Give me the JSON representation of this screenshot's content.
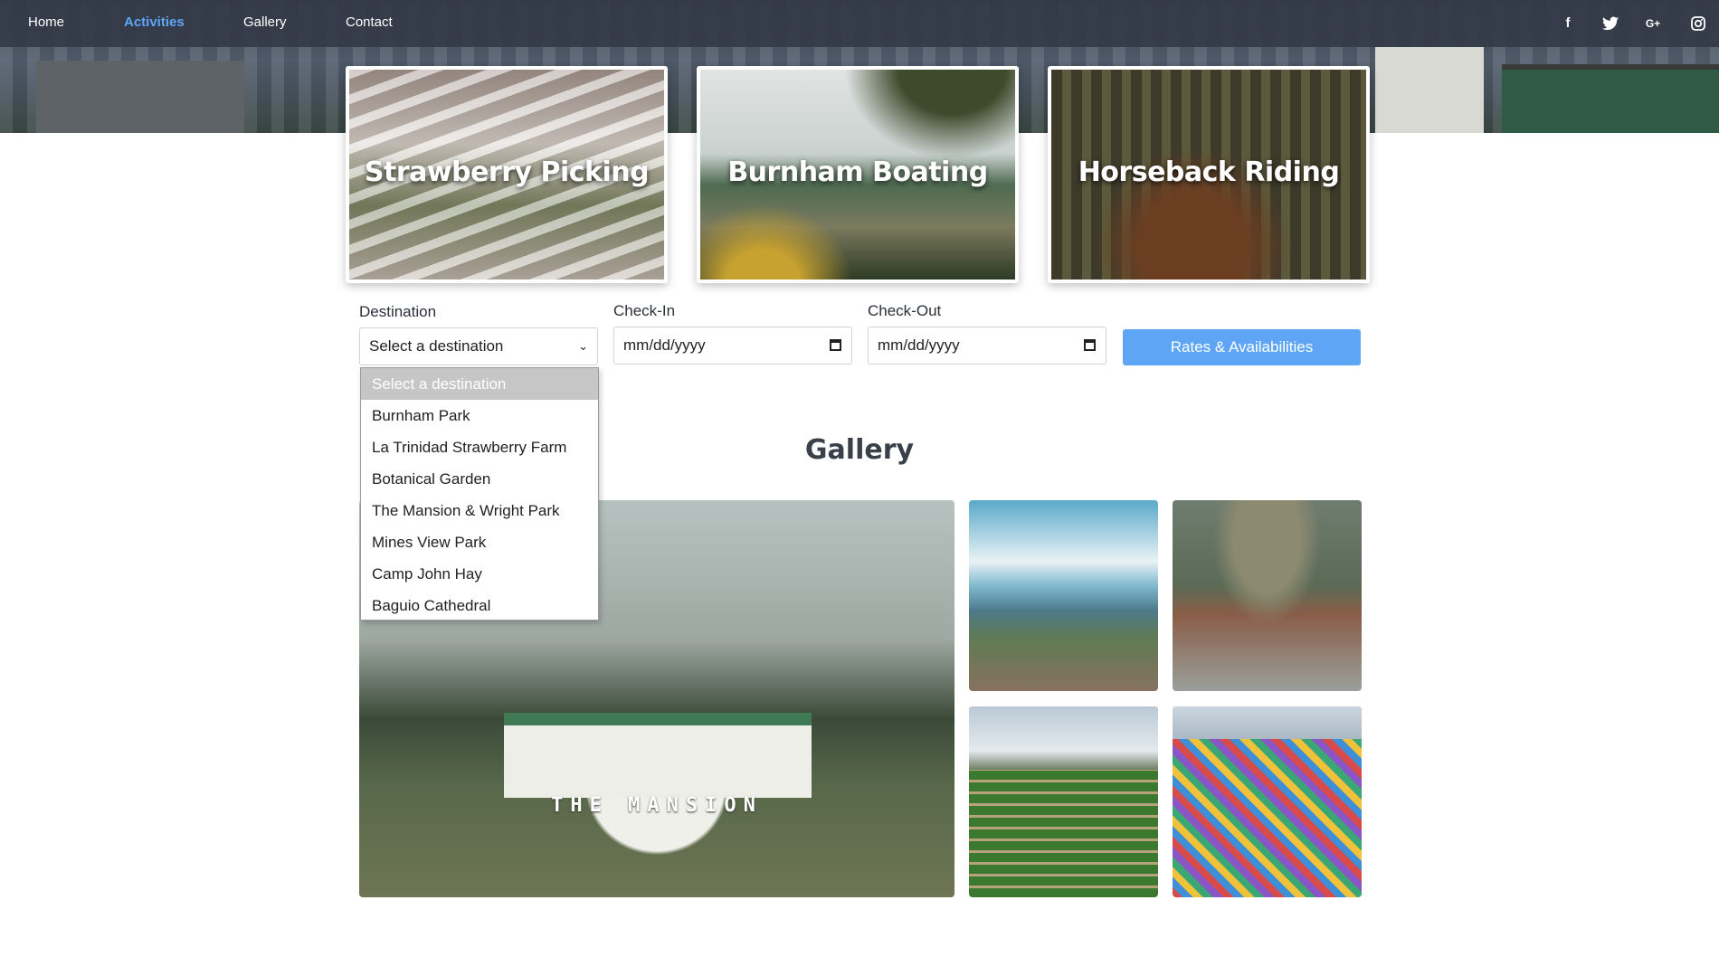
{
  "nav": {
    "items": [
      "Home",
      "Activities",
      "Gallery",
      "Contact"
    ],
    "active": "Activities",
    "social": {
      "facebook": "f",
      "twitter": "🐦",
      "google_plus": "G+",
      "instagram": "◎"
    }
  },
  "activities": [
    {
      "title": "Strawberry Picking"
    },
    {
      "title": "Burnham Boating"
    },
    {
      "title": "Horseback Riding"
    }
  ],
  "booking": {
    "destination_label": "Destination",
    "destination_value": "Select a destination",
    "checkin_label": "Check-In",
    "checkin_placeholder": "mm/dd/yyyy",
    "checkout_label": "Check-Out",
    "checkout_placeholder": "mm/dd/yyyy",
    "submit_label": "Rates & Availabilities",
    "options": [
      "Select a destination",
      "Burnham Park",
      "La Trinidad Strawberry Farm",
      "Botanical Garden",
      "The Mansion & Wright Park",
      "Mines View Park",
      "Camp John Hay",
      "Baguio Cathedral"
    ]
  },
  "gallery": {
    "title": "Gallery",
    "main_sign": "THE MANSION"
  },
  "colors": {
    "accent": "#5ea6f5",
    "navbar": "#343a48"
  }
}
